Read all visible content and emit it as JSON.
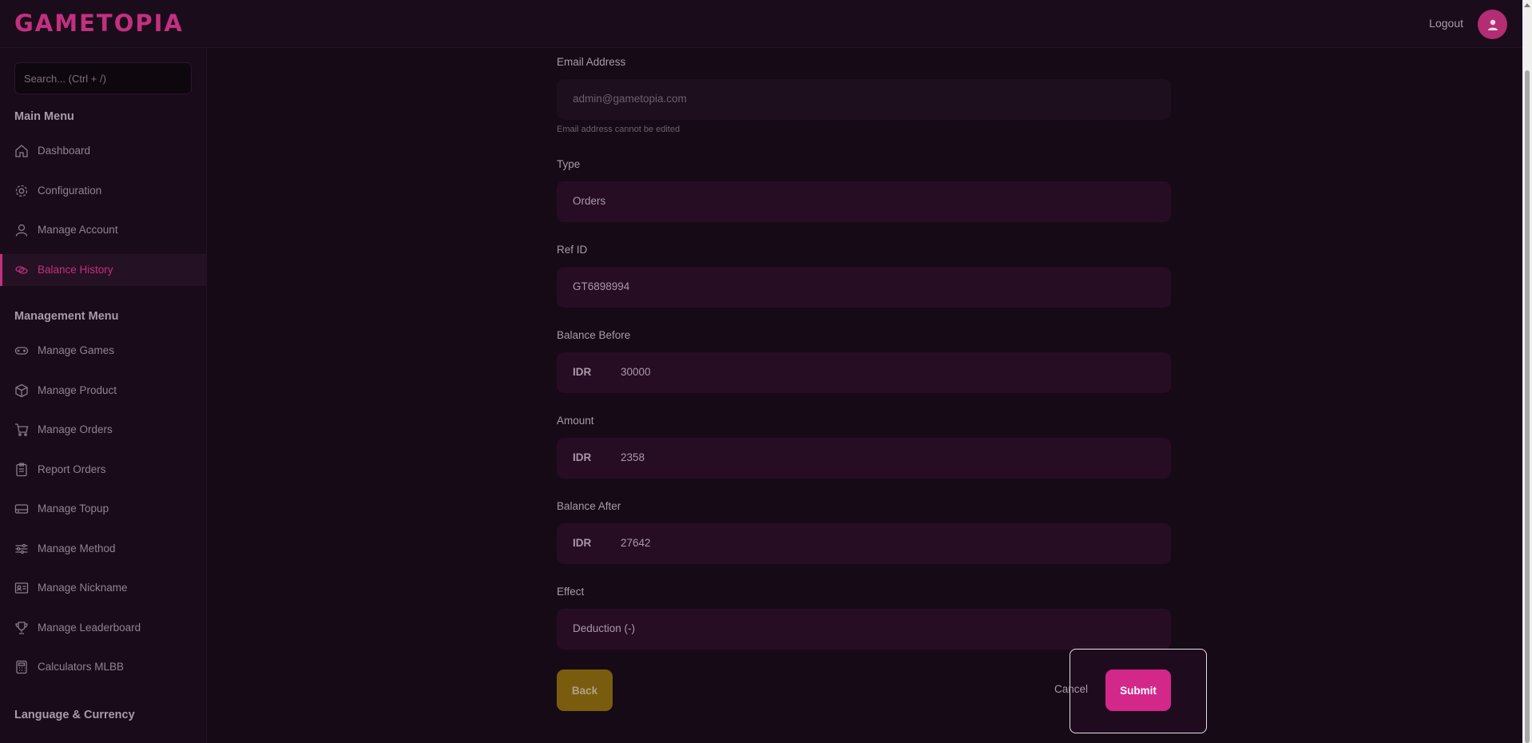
{
  "header": {
    "logo": "GAMETOPIA",
    "logout_label": "Logout",
    "avatar_icon": "user-icon"
  },
  "sidebar": {
    "search_placeholder": "Search... (Ctrl + /)",
    "main_menu_title": "Main Menu",
    "main_items": [
      {
        "label": "Dashboard",
        "icon": "home-icon"
      },
      {
        "label": "Configuration",
        "icon": "gear-icon"
      },
      {
        "label": "Manage Account",
        "icon": "user-icon"
      },
      {
        "label": "Balance History",
        "icon": "coins-icon",
        "active": true
      }
    ],
    "management_menu_title": "Management Menu",
    "management_items": [
      {
        "label": "Manage Games",
        "icon": "gamepad-icon"
      },
      {
        "label": "Manage Product",
        "icon": "box-icon"
      },
      {
        "label": "Manage Orders",
        "icon": "cart-icon"
      },
      {
        "label": "Report Orders",
        "icon": "clipboard-icon"
      },
      {
        "label": "Manage Topup",
        "icon": "card-icon"
      },
      {
        "label": "Manage Method",
        "icon": "sliders-icon"
      },
      {
        "label": "Manage Nickname",
        "icon": "id-card-icon"
      },
      {
        "label": "Manage Leaderboard",
        "icon": "trophy-icon"
      },
      {
        "label": "Calculators MLBB",
        "icon": "calculator-icon"
      }
    ],
    "language_title": "Language & Currency"
  },
  "form": {
    "email": {
      "label": "Email Address",
      "value": "admin@gametopia.com",
      "hint": "Email address cannot be edited"
    },
    "type": {
      "label": "Type",
      "value": "Orders"
    },
    "ref_id": {
      "label": "Ref ID",
      "value": "GT6898994"
    },
    "balance_before": {
      "label": "Balance Before",
      "currency": "IDR",
      "value": "30000"
    },
    "amount": {
      "label": "Amount",
      "currency": "IDR",
      "value": "2358"
    },
    "balance_after": {
      "label": "Balance After",
      "currency": "IDR",
      "value": "27642"
    },
    "effect": {
      "label": "Effect",
      "value": "Deduction (-)"
    },
    "back_label": "Back",
    "cancel_label": "Cancel",
    "submit_label": "Submit"
  },
  "colors": {
    "accent": "#c2307f",
    "submit": "#d4278a",
    "back": "#7a5c0e",
    "background": "#160a16"
  }
}
